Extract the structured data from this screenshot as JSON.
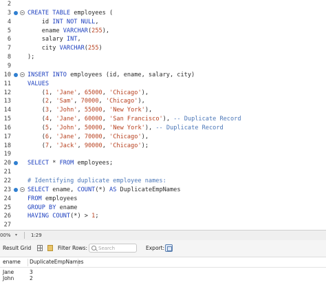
{
  "editor": {
    "lines": [
      {
        "n": "2",
        "marker": false,
        "fold": false,
        "tokens": []
      },
      {
        "n": "3",
        "marker": true,
        "fold": true,
        "tokens": [
          [
            "kw",
            "CREATE TABLE "
          ],
          [
            "pl",
            "employees ("
          ]
        ]
      },
      {
        "n": "4",
        "marker": false,
        "fold": false,
        "tokens": [
          [
            "pl",
            "    id "
          ],
          [
            "kw",
            "INT NOT NULL"
          ],
          [
            "pl",
            ","
          ]
        ]
      },
      {
        "n": "5",
        "marker": false,
        "fold": false,
        "tokens": [
          [
            "pl",
            "    ename "
          ],
          [
            "kw",
            "VARCHAR"
          ],
          [
            "pl",
            "("
          ],
          [
            "num",
            "255"
          ],
          [
            "pl",
            "),"
          ]
        ]
      },
      {
        "n": "6",
        "marker": false,
        "fold": false,
        "tokens": [
          [
            "pl",
            "    salary "
          ],
          [
            "kw",
            "INT"
          ],
          [
            "pl",
            ","
          ]
        ]
      },
      {
        "n": "7",
        "marker": false,
        "fold": false,
        "tokens": [
          [
            "pl",
            "    city "
          ],
          [
            "kw",
            "VARCHAR"
          ],
          [
            "pl",
            "("
          ],
          [
            "num",
            "255"
          ],
          [
            "pl",
            ")"
          ]
        ]
      },
      {
        "n": "8",
        "marker": false,
        "fold": false,
        "tokens": [
          [
            "pl",
            ");"
          ]
        ]
      },
      {
        "n": "9",
        "marker": false,
        "fold": false,
        "tokens": []
      },
      {
        "n": "10",
        "marker": true,
        "fold": true,
        "tokens": [
          [
            "kw",
            "INSERT INTO "
          ],
          [
            "pl",
            "employees (id, ename, salary, city)"
          ]
        ]
      },
      {
        "n": "11",
        "marker": false,
        "fold": false,
        "tokens": [
          [
            "kw",
            "VALUES"
          ]
        ]
      },
      {
        "n": "12",
        "marker": false,
        "fold": false,
        "tokens": [
          [
            "pl",
            "    ("
          ],
          [
            "num",
            "1"
          ],
          [
            "pl",
            ", "
          ],
          [
            "str",
            "'Jane'"
          ],
          [
            "pl",
            ", "
          ],
          [
            "num",
            "65000"
          ],
          [
            "pl",
            ", "
          ],
          [
            "str",
            "'Chicago'"
          ],
          [
            "pl",
            "),"
          ]
        ]
      },
      {
        "n": "13",
        "marker": false,
        "fold": false,
        "tokens": [
          [
            "pl",
            "    ("
          ],
          [
            "num",
            "2"
          ],
          [
            "pl",
            ", "
          ],
          [
            "str",
            "'Sam'"
          ],
          [
            "pl",
            ", "
          ],
          [
            "num",
            "70000"
          ],
          [
            "pl",
            ", "
          ],
          [
            "str",
            "'Chicago'"
          ],
          [
            "pl",
            "),"
          ]
        ]
      },
      {
        "n": "14",
        "marker": false,
        "fold": false,
        "tokens": [
          [
            "pl",
            "    ("
          ],
          [
            "num",
            "3"
          ],
          [
            "pl",
            ", "
          ],
          [
            "str",
            "'John'"
          ],
          [
            "pl",
            ", "
          ],
          [
            "num",
            "55000"
          ],
          [
            "pl",
            ", "
          ],
          [
            "str",
            "'New York'"
          ],
          [
            "pl",
            "),"
          ]
        ]
      },
      {
        "n": "15",
        "marker": false,
        "fold": false,
        "tokens": [
          [
            "pl",
            "    ("
          ],
          [
            "num",
            "4"
          ],
          [
            "pl",
            ", "
          ],
          [
            "str",
            "'Jane'"
          ],
          [
            "pl",
            ", "
          ],
          [
            "num",
            "60000"
          ],
          [
            "pl",
            ", "
          ],
          [
            "str",
            "'San Francisco'"
          ],
          [
            "pl",
            "), "
          ],
          [
            "cmt",
            "-- Duplicate Record"
          ]
        ]
      },
      {
        "n": "16",
        "marker": false,
        "fold": false,
        "tokens": [
          [
            "pl",
            "    ("
          ],
          [
            "num",
            "5"
          ],
          [
            "pl",
            ", "
          ],
          [
            "str",
            "'John'"
          ],
          [
            "pl",
            ", "
          ],
          [
            "num",
            "50000"
          ],
          [
            "pl",
            ", "
          ],
          [
            "str",
            "'New York'"
          ],
          [
            "pl",
            "), "
          ],
          [
            "cmt",
            "-- Duplicate Record"
          ]
        ]
      },
      {
        "n": "17",
        "marker": false,
        "fold": false,
        "tokens": [
          [
            "pl",
            "    ("
          ],
          [
            "num",
            "6"
          ],
          [
            "pl",
            ", "
          ],
          [
            "str",
            "'Jane'"
          ],
          [
            "pl",
            ", "
          ],
          [
            "num",
            "70000"
          ],
          [
            "pl",
            ", "
          ],
          [
            "str",
            "'Chicago'"
          ],
          [
            "pl",
            "),"
          ]
        ]
      },
      {
        "n": "18",
        "marker": false,
        "fold": false,
        "tokens": [
          [
            "pl",
            "    ("
          ],
          [
            "num",
            "7"
          ],
          [
            "pl",
            ", "
          ],
          [
            "str",
            "'Jack'"
          ],
          [
            "pl",
            ", "
          ],
          [
            "num",
            "90000"
          ],
          [
            "pl",
            ", "
          ],
          [
            "str",
            "'Chicago'"
          ],
          [
            "pl",
            ");"
          ]
        ]
      },
      {
        "n": "19",
        "marker": false,
        "fold": false,
        "tokens": []
      },
      {
        "n": "20",
        "marker": true,
        "fold": false,
        "tokens": [
          [
            "kw",
            "SELECT "
          ],
          [
            "pl",
            "* "
          ],
          [
            "kw",
            "FROM "
          ],
          [
            "pl",
            "employees;"
          ]
        ]
      },
      {
        "n": "21",
        "marker": false,
        "fold": false,
        "tokens": []
      },
      {
        "n": "22",
        "marker": false,
        "fold": false,
        "tokens": [
          [
            "cmt",
            "# Identifying duplicate employee names:"
          ]
        ]
      },
      {
        "n": "23",
        "marker": true,
        "fold": true,
        "tokens": [
          [
            "kw",
            "SELECT "
          ],
          [
            "pl",
            "ename, "
          ],
          [
            "kw",
            "COUNT"
          ],
          [
            "pl",
            "(*) "
          ],
          [
            "kw",
            "AS "
          ],
          [
            "pl",
            "DuplicateEmpNames"
          ]
        ]
      },
      {
        "n": "24",
        "marker": false,
        "fold": false,
        "tokens": [
          [
            "kw",
            "FROM "
          ],
          [
            "pl",
            "employees"
          ]
        ]
      },
      {
        "n": "25",
        "marker": false,
        "fold": false,
        "tokens": [
          [
            "kw",
            "GROUP BY "
          ],
          [
            "pl",
            "ename"
          ]
        ]
      },
      {
        "n": "26",
        "marker": false,
        "fold": false,
        "tokens": [
          [
            "kw",
            "HAVING "
          ],
          [
            "kw",
            "COUNT"
          ],
          [
            "pl",
            "(*) > "
          ],
          [
            "num",
            "1"
          ],
          [
            "pl",
            ";"
          ]
        ]
      },
      {
        "n": "27",
        "marker": false,
        "fold": false,
        "tokens": []
      }
    ]
  },
  "status": {
    "zoom": "00%",
    "cursor": "1:29"
  },
  "toolbar": {
    "result_grid_label": "Result Grid",
    "filter_label": "Filter Rows:",
    "search_placeholder": "Search",
    "export_label": "Export:"
  },
  "result": {
    "columns": [
      "ename",
      "DuplicateEmpNames"
    ],
    "rows": [
      [
        "Jane",
        "3"
      ],
      [
        "John",
        "2"
      ]
    ]
  },
  "colors": {
    "keyword": "#1c3fbf",
    "string": "#b8411f",
    "comment": "#4a76b8",
    "marker": "#2f7fd0"
  }
}
